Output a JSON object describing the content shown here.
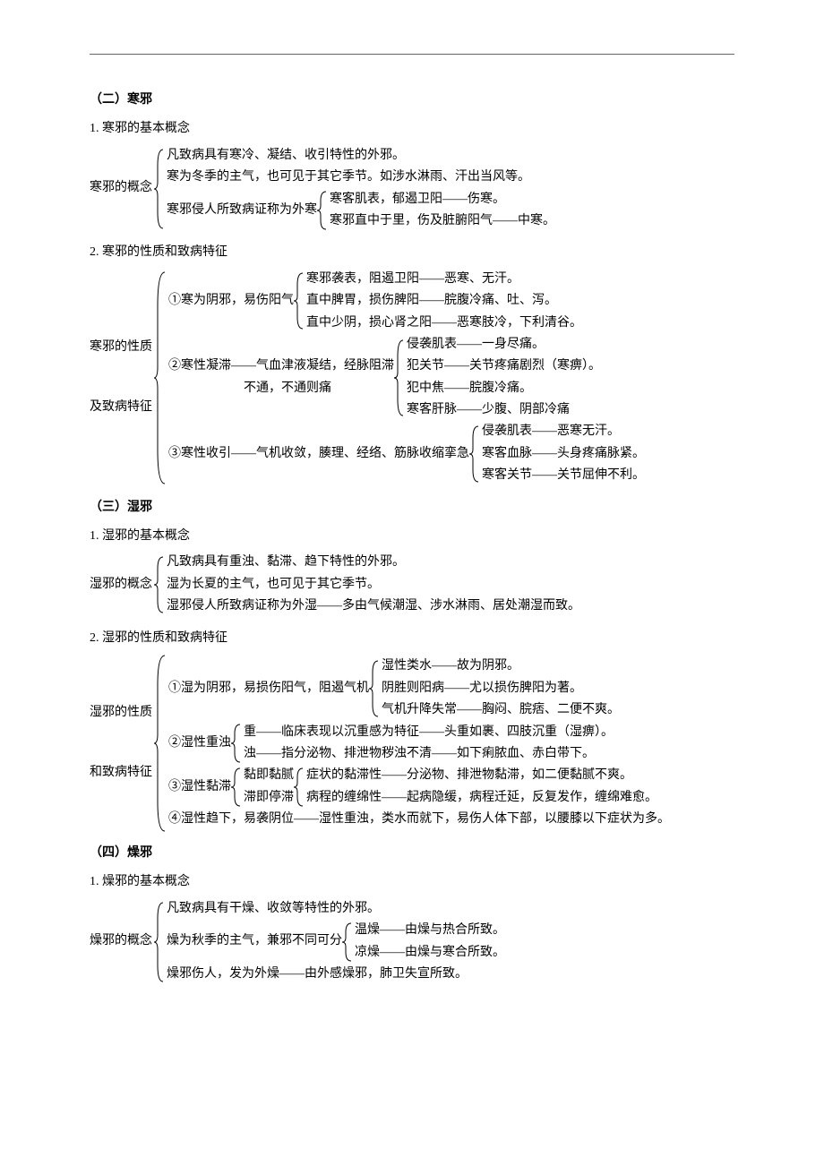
{
  "s2": {
    "title": "（二）寒邪",
    "h1": "1. 寒邪的基本概念",
    "concept_label": "寒邪的概念",
    "concept_lines": {
      "l1": "凡致病具有寒冷、凝结、收引特性的外邪。",
      "l2": "寒为冬季的主气，也可见于其它季节。如涉水淋雨、汗出当风等。",
      "l3pre": "寒邪侵人所致病证称为外寒",
      "l3a": "寒客肌表，郁遏卫阳——伤寒。",
      "l3b": "寒邪直中于里，伤及脏腑阳气——中寒。"
    },
    "h2": "2. 寒邪的性质和致病特征",
    "nature_label1": "寒邪的性质",
    "nature_label2": "及致病特征",
    "n1pre": "①寒为阴邪，易伤阳气",
    "n1a": "寒邪袭表，阻遏卫阳——恶寒、无汗。",
    "n1b": "直中脾胃，损伤脾阳——脘腹冷痛、吐、泻。",
    "n1c": "直中少阴，损心肾之阳——恶寒肢冷，下利清谷。",
    "n2pre1": "②寒性凝滞——气血津液凝结，经脉阻滞",
    "n2pre2": "　　　　　　不通，不通则痛",
    "n2a": "侵袭肌表——一身尽痛。",
    "n2b": "犯关节——关节疼痛剧烈（寒痹）。",
    "n2c": "犯中焦——脘腹冷痛。",
    "n2d": "寒客肝脉——少腹、阴部冷痛",
    "n3pre": "③寒性收引——气机收敛，腠理、经络、筋脉收缩挛急",
    "n3a": "侵袭肌表——恶寒无汗。",
    "n3b": "寒客血脉——头身疼痛脉紧。",
    "n3c": "寒客关节——关节屈伸不利。"
  },
  "s3": {
    "title": "（三）湿邪",
    "h1": "1. 湿邪的基本概念",
    "concept_label": "湿邪的概念",
    "c1": "凡致病具有重浊、黏滞、趋下特性的外邪。",
    "c2": "湿为长夏的主气，也可见于其它季节。",
    "c3": "湿邪侵人所致病证称为外湿——多由气候潮湿、涉水淋雨、居处潮湿而致。",
    "h2": "2. 湿邪的性质和致病特征",
    "nature_label1": "湿邪的性质",
    "nature_label2": "和致病特征",
    "n1pre": "①湿为阴邪，易损伤阳气，阻遏气机",
    "n1a": "湿性类水——故为阴邪。",
    "n1b": "阴胜则阳病——尤以损伤脾阳为著。",
    "n1c": "气机升降失常——胸闷、脘痞、二便不爽。",
    "n2pre": "②湿性重浊",
    "n2a": "重——临床表现以沉重感为特征——头重如裹、四肢沉重（湿痹）。",
    "n2b": "浊——指分泌物、排泄物秽浊不清——如下痢脓血、赤白带下。",
    "n3pre": "③湿性黏滞",
    "n3mid1": "黏即黏腻",
    "n3mid2": "滞即停滞",
    "n3a": "症状的黏滞性——分泌物、排泄物黏滞，如二便黏腻不爽。",
    "n3b": "病程的缠绵性——起病隐缓，病程迁延，反复发作，缠绵难愈。",
    "n4": "④湿性趋下，易袭阴位——湿性重浊，类水而就下，易伤人体下部，以腰膝以下症状为多。"
  },
  "s4": {
    "title": "（四）燥邪",
    "h1": "1. 燥邪的基本概念",
    "concept_label": "燥邪的概念",
    "c1": "凡致病具有干燥、收敛等特性的外邪。",
    "c2pre": "燥为秋季的主气，兼邪不同可分",
    "c2a": "温燥——由燥与热合所致。",
    "c2b": "凉燥——由燥与寒合所致。",
    "c3": "燥邪伤人，发为外燥——由外感燥邪，肺卫失宣所致。"
  }
}
